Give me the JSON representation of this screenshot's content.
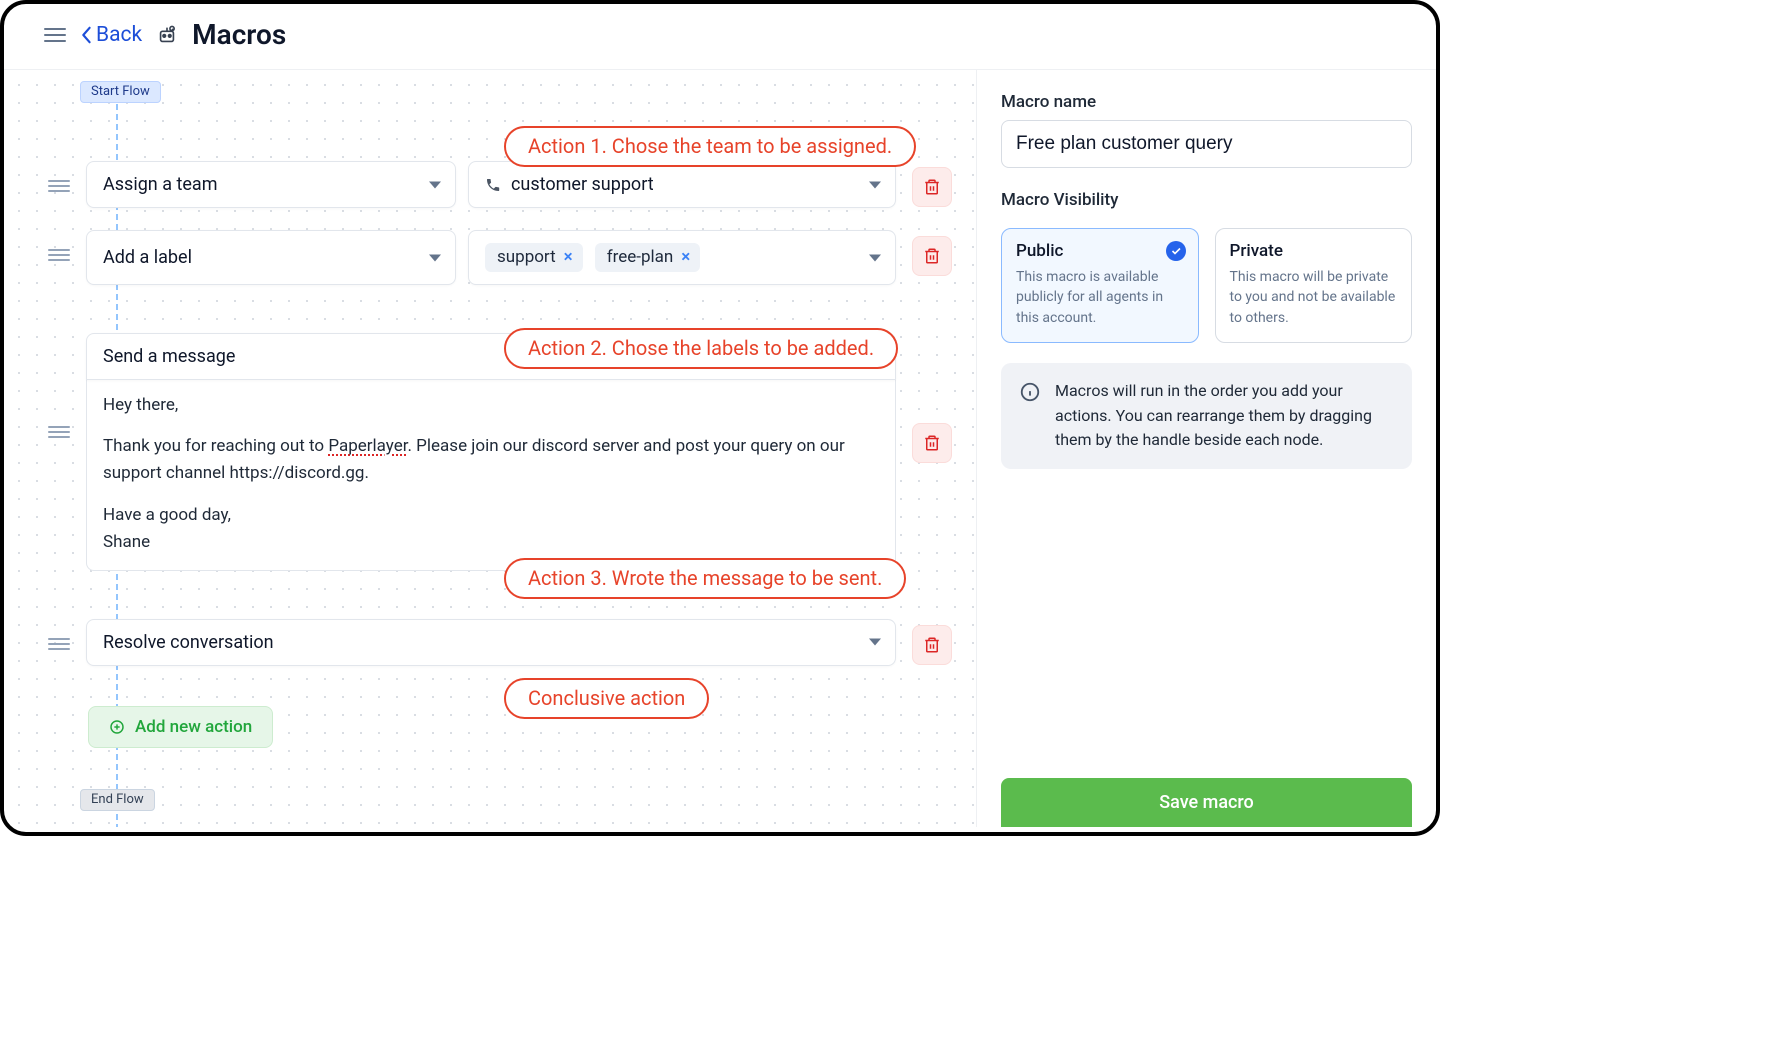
{
  "header": {
    "back": "Back",
    "title": "Macros"
  },
  "flow": {
    "start": "Start Flow",
    "end": "End Flow",
    "add_action": "Add new action"
  },
  "actions": {
    "a1_select": "Assign a team",
    "a1_value": "customer support",
    "a2_select": "Add a label",
    "a2_tags": {
      "t1": "support",
      "t2": "free-plan"
    },
    "a3_select": "Send a message",
    "a3_body_greeting": "Hey there,",
    "a3_body_p1a": "Thank you for reaching out to ",
    "a3_body_p1b": "Paperlayer",
    "a3_body_p1c": ". Please join our discord server and post your query on our support channel https://discord.gg.",
    "a3_body_sig1": "Have a good day,",
    "a3_body_sig2": "Shane",
    "a4_select": "Resolve conversation"
  },
  "annotations": {
    "a1": "Action 1. Chose the team to be assigned.",
    "a2": "Action 2. Chose the labels to be added.",
    "a3": "Action 3. Wrote the message to be sent.",
    "a4": "Conclusive action"
  },
  "panel": {
    "name_label": "Macro name",
    "name_value": "Free plan customer query",
    "visibility_label": "Macro Visibility",
    "public_title": "Public",
    "public_desc": "This macro is available publicly for all agents in this account.",
    "private_title": "Private",
    "private_desc": "This macro will be private to you and not be available to others.",
    "info_text": "Macros will run in the order you add your actions. You can rearrange them by dragging them by the handle beside each node.",
    "save": "Save macro"
  }
}
